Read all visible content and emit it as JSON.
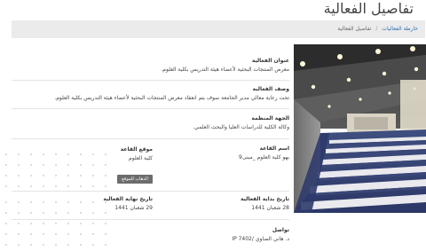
{
  "header": {
    "title": "تفاصيل الفعالية"
  },
  "breadcrumb": {
    "link": "خارطة الفعاليات",
    "separator": "/",
    "current": "تفاصيل الفعالية"
  },
  "details": {
    "event_title_label": "عنوان الفعالية",
    "event_title_value": "معرض المنتجات البحثية لأعضاء هيئة التدريس بكلية العلوم.",
    "description_label": "وصف الفعالية",
    "description_value": "تحت رعاية معالي مدير الجامعة سوف يتم انعقاد معرض المنتجات البحثية لأعضاء هيئة التدريس بكلية العلوم.",
    "organizer_label": "الجهة المنظمة",
    "organizer_value": "وكالة الكلية للدراسات العليا والبحث العلمي.",
    "hall_name_label": "اسم القاعة",
    "hall_name_value": "بهو كلية العلوم _مبنى9",
    "hall_location_label": "موقع القاعة",
    "hall_location_value": "كلية العلوم",
    "map_button_label": "الذهاب للموقع",
    "start_date_label": "تاريخ بداية الفعالية",
    "start_date_value": "28 شعبان 1441",
    "end_date_label": "تاريخ نهاية الفعالية",
    "end_date_value": "29 شعبان 1441",
    "contact_label": "تواصل",
    "contact_value": "د. هاني الصاوي /IP 7402"
  },
  "colors": {
    "link": "#2a6fb0",
    "breadcrumb_bg": "#ebebeb",
    "button_bg": "#6c6c6c"
  }
}
